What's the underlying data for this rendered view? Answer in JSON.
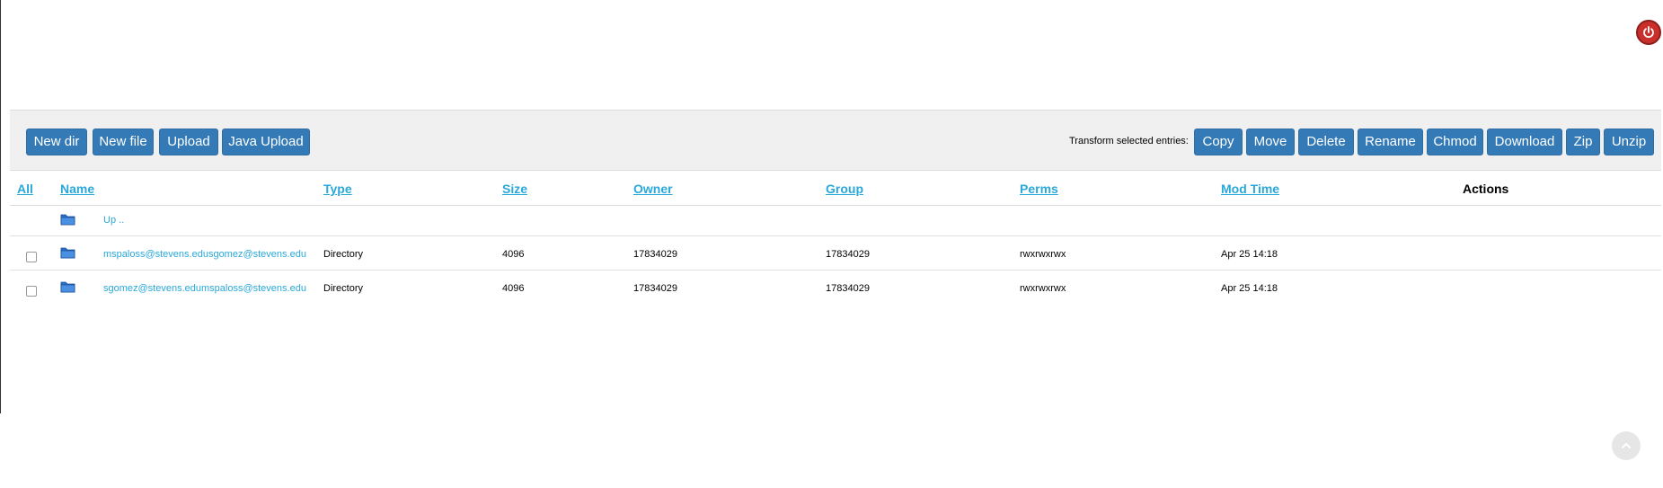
{
  "toolbar": {
    "new_dir": "New dir",
    "new_file": "New file",
    "upload": "Upload",
    "java_upload": "Java Upload",
    "transform_label": "Transform selected entries:",
    "copy": "Copy",
    "move": "Move",
    "delete": "Delete",
    "rename": "Rename",
    "chmod": "Chmod",
    "download": "Download",
    "zip": "Zip",
    "unzip": "Unzip"
  },
  "table": {
    "headers": {
      "all": "All",
      "name": "Name",
      "type": "Type",
      "size": "Size",
      "owner": "Owner",
      "group": "Group",
      "perms": "Perms",
      "mod_time": "Mod Time",
      "actions": "Actions"
    },
    "up": "Up ..",
    "rows": [
      {
        "name": "mspaloss@stevens.edusgomez@stevens.edu",
        "type": "Directory",
        "size": "4096",
        "owner": "17834029",
        "group": "17834029",
        "perms": "rwxrwxrwx",
        "mod_time": "Apr 25 14:18"
      },
      {
        "name": "sgomez@stevens.edumspaloss@stevens.edu",
        "type": "Directory",
        "size": "4096",
        "owner": "17834029",
        "group": "17834029",
        "perms": "rwxrwxrwx",
        "mod_time": "Apr 25 14:18"
      }
    ]
  },
  "icons": {
    "power": "power-icon",
    "folder": "folder-icon",
    "scroll": "scroll-top-icon"
  },
  "colors": {
    "button": "#337ab7",
    "link": "#29a8d9",
    "power": "#c9302c"
  }
}
